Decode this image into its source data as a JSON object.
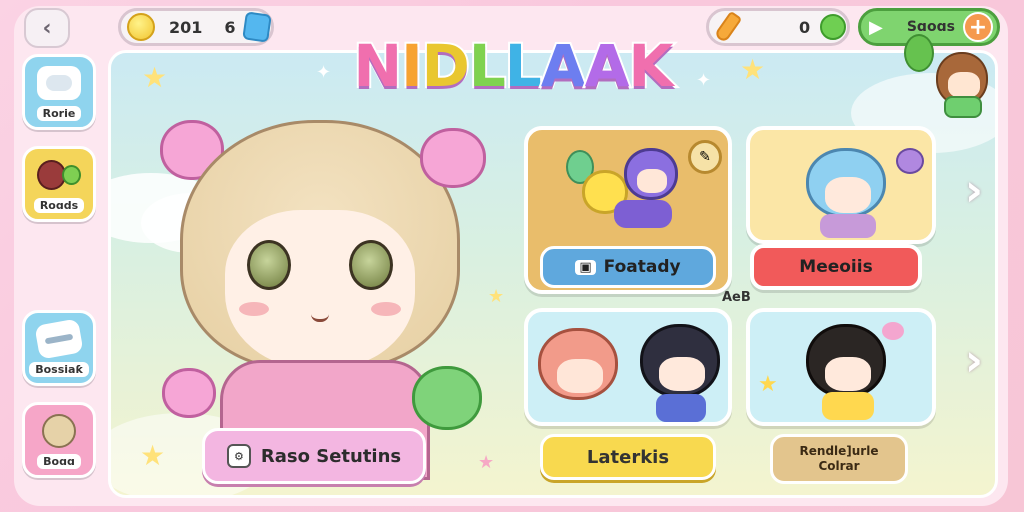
{
  "title": {
    "letters": [
      "N",
      "I",
      "D",
      "L",
      "L",
      "A",
      "A",
      "K"
    ],
    "colors": [
      "#f06fae",
      "#f7a331",
      "#e9c72f",
      "#7fd24f",
      "#3fb3e6",
      "#6d7ef0",
      "#b36be8",
      "#f06fae"
    ]
  },
  "resources": {
    "coins_value": "201",
    "gems_value": "6",
    "carrots_value": "0",
    "shop_label": "Sɑoɑs"
  },
  "sidebar": {
    "items": [
      {
        "label": "Rorie",
        "icon": "cloud-icon"
      },
      {
        "label": "Roɑds",
        "icon": "character-icon"
      },
      {
        "label": "Bossiaƙ",
        "icon": "card-icon"
      },
      {
        "label": "Boɑɑ",
        "icon": "avatar-icon"
      }
    ]
  },
  "hero": {
    "button_label": "Raso Setutins"
  },
  "cards": [
    {
      "label": "Foatady",
      "icon": "game-icon"
    },
    {
      "label": "Meeoiis"
    },
    {
      "label": "Laterkis"
    },
    {
      "label": "Rendle]urle",
      "line2": "Colrar"
    }
  ],
  "middle_label": "AeB",
  "colors": {
    "pink_accent": "#f3b6e1",
    "blue_pill": "#5fa8dd",
    "red_pill": "#f15a5a",
    "yellow_pill": "#f8d94f",
    "tan_pill": "#e3c58d"
  }
}
